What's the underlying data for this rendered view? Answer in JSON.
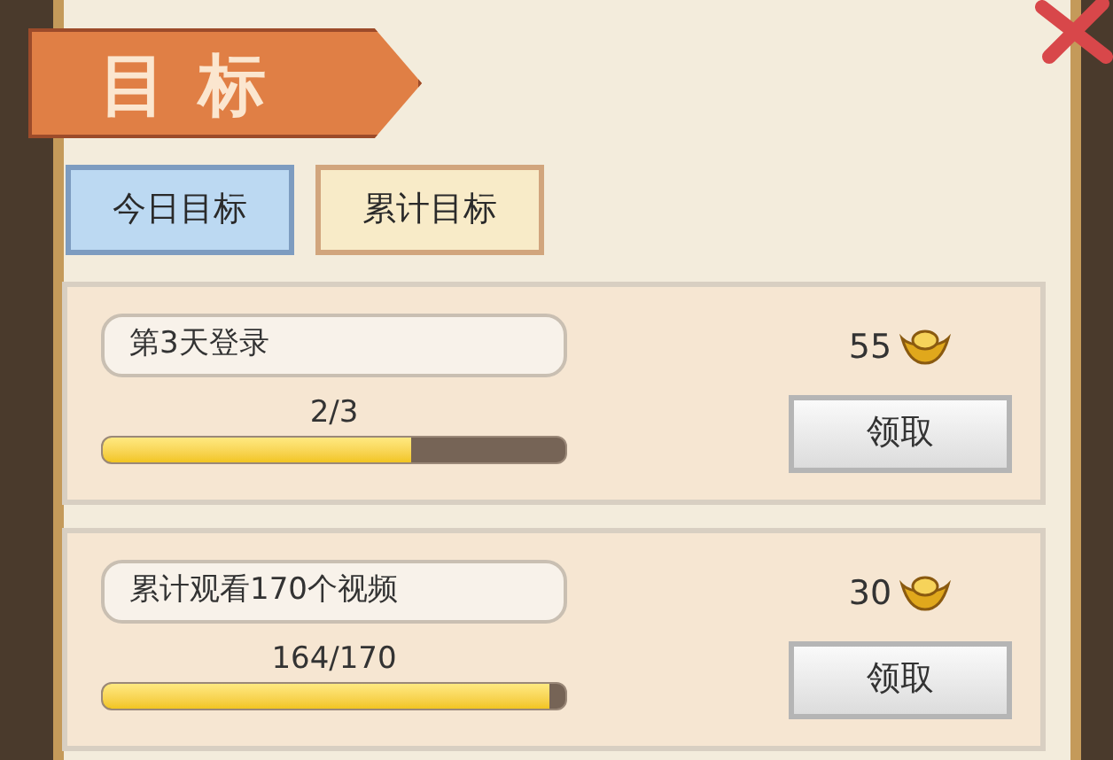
{
  "title": "目标",
  "tabs": [
    {
      "label": "今日目标",
      "selected": true
    },
    {
      "label": "累计目标",
      "selected": false
    }
  ],
  "goals": [
    {
      "name": "第3天登录",
      "progress": "2/3",
      "level": 0.667,
      "reward": "55",
      "button": "领取"
    },
    {
      "name": "累计观看170个视频",
      "progress": "164/170",
      "level": 0.965,
      "reward": "30",
      "button": "领取"
    }
  ]
}
